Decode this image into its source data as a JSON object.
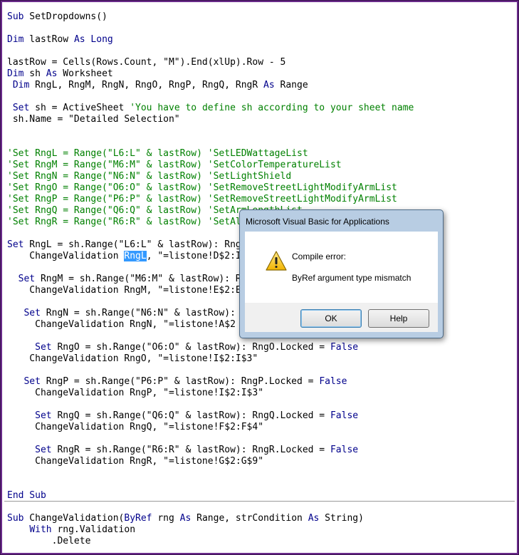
{
  "code_lines": [
    [
      {
        "t": "Sub SetDropdowns()",
        "c": "kw-start"
      }
    ],
    [],
    [
      {
        "t": "Dim",
        "c": "kw"
      },
      {
        "t": " lastRow "
      },
      {
        "t": "As Long",
        "c": "kw"
      }
    ],
    [],
    [
      {
        "t": "lastRow = Cells(Rows.Count, \"M\").End(xlUp).Row - 5"
      }
    ],
    [
      {
        "t": "Dim",
        "c": "kw"
      },
      {
        "t": " sh "
      },
      {
        "t": "As",
        "c": "kw"
      },
      {
        "t": " Worksheet"
      }
    ],
    [
      {
        "t": " "
      },
      {
        "t": "Dim",
        "c": "kw"
      },
      {
        "t": " RngL, RngM, RngN, RngO, RngP, RngQ, RngR "
      },
      {
        "t": "As",
        "c": "kw"
      },
      {
        "t": " Range"
      }
    ],
    [],
    [
      {
        "t": " "
      },
      {
        "t": "Set",
        "c": "kw"
      },
      {
        "t": " sh = ActiveSheet "
      },
      {
        "t": "'You have to define sh according to your sheet name",
        "c": "cm"
      }
    ],
    [
      {
        "t": " sh.Name = \"Detailed Selection\""
      }
    ],
    [],
    [],
    [
      {
        "t": "'Set RngL = Range(\"L6:L\" & lastRow) 'SetLEDWattageList",
        "c": "cm"
      }
    ],
    [
      {
        "t": "'Set RngM = Range(\"M6:M\" & lastRow) 'SetColorTemperatureList",
        "c": "cm"
      }
    ],
    [
      {
        "t": "'Set RngN = Range(\"N6:N\" & lastRow) 'SetLightShield",
        "c": "cm"
      }
    ],
    [
      {
        "t": "'Set RngO = Range(\"O6:O\" & lastRow) 'SetRemoveStreetLightModifyArmList",
        "c": "cm"
      }
    ],
    [
      {
        "t": "'Set RngP = Range(\"P6:P\" & lastRow) 'SetRemoveStreetLightModifyArmList",
        "c": "cm"
      }
    ],
    [
      {
        "t": "'Set RngQ = Range(\"Q6:Q\" & lastRow) 'SetArmLengthList",
        "c": "cm"
      }
    ],
    [
      {
        "t": "'Set RngR = Range(\"R6:R\" & lastRow) 'SetAl",
        "c": "cm"
      }
    ],
    [],
    [
      {
        "t": "Set",
        "c": "kw"
      },
      {
        "t": " RngL = sh.Range(\"L6:L\" & lastRow): Rng"
      }
    ],
    [
      {
        "t": "    ChangeValidation "
      },
      {
        "t": "RngL",
        "c": "sel"
      },
      {
        "t": ", \"=listone!D$2:I"
      }
    ],
    [],
    [
      {
        "t": "  "
      },
      {
        "t": "Set",
        "c": "kw"
      },
      {
        "t": " RngM = sh.Range(\"M6:M\" & lastRow): R"
      }
    ],
    [
      {
        "t": "    ChangeValidation RngM, \"=listone!E$2:E"
      }
    ],
    [],
    [
      {
        "t": "   "
      },
      {
        "t": "Set",
        "c": "kw"
      },
      {
        "t": " RngN = sh.Range(\"N6:N\" & lastRow):"
      }
    ],
    [
      {
        "t": "     ChangeValidation RngN, \"=listone!A$2"
      }
    ],
    [],
    [
      {
        "t": "     "
      },
      {
        "t": "Set",
        "c": "kw"
      },
      {
        "t": " RngO = sh.Range(\"O6:O\" & lastRow): RngO.Locked = "
      },
      {
        "t": "False",
        "c": "kw"
      }
    ],
    [
      {
        "t": "    ChangeValidation RngO, \"=listone!I$2:I$3\""
      }
    ],
    [],
    [
      {
        "t": "   "
      },
      {
        "t": "Set",
        "c": "kw"
      },
      {
        "t": " RngP = sh.Range(\"P6:P\" & lastRow): RngP.Locked = "
      },
      {
        "t": "False",
        "c": "kw"
      }
    ],
    [
      {
        "t": "     ChangeValidation RngP, \"=listone!I$2:I$3\""
      }
    ],
    [],
    [
      {
        "t": "     "
      },
      {
        "t": "Set",
        "c": "kw"
      },
      {
        "t": " RngQ = sh.Range(\"Q6:Q\" & lastRow): RngQ.Locked = "
      },
      {
        "t": "False",
        "c": "kw"
      }
    ],
    [
      {
        "t": "     ChangeValidation RngQ, \"=listone!F$2:F$4\""
      }
    ],
    [],
    [
      {
        "t": "     "
      },
      {
        "t": "Set",
        "c": "kw"
      },
      {
        "t": " RngR = sh.Range(\"R6:R\" & lastRow): RngR.Locked = "
      },
      {
        "t": "False",
        "c": "kw"
      }
    ],
    [
      {
        "t": "     ChangeValidation RngR, \"=listone!G$2:G$9\""
      }
    ],
    [],
    [],
    [
      {
        "t": "End Sub",
        "c": "kw"
      }
    ],
    [],
    [
      {
        "t": "Sub",
        "c": "kw"
      },
      {
        "t": " ChangeValidation("
      },
      {
        "t": "ByRef",
        "c": "kw"
      },
      {
        "t": " rng "
      },
      {
        "t": "As",
        "c": "kw"
      },
      {
        "t": " Range, strCondition "
      },
      {
        "t": "As",
        "c": "kw"
      },
      {
        "t": " String)"
      }
    ],
    [
      {
        "t": "    "
      },
      {
        "t": "With",
        "c": "kw"
      },
      {
        "t": " rng.Validation"
      }
    ],
    [
      {
        "t": "        .Delete"
      }
    ]
  ],
  "dialog": {
    "title": "Microsoft Visual Basic for Applications",
    "icon": "warning-icon",
    "message_title": "Compile error:",
    "message_detail": "ByRef argument type mismatch",
    "ok_label": "OK",
    "help_label": "Help"
  },
  "colors": {
    "keyword": "#00008b",
    "comment": "#008000",
    "selection": "#3399ff",
    "frame": "#6a2a8a"
  }
}
